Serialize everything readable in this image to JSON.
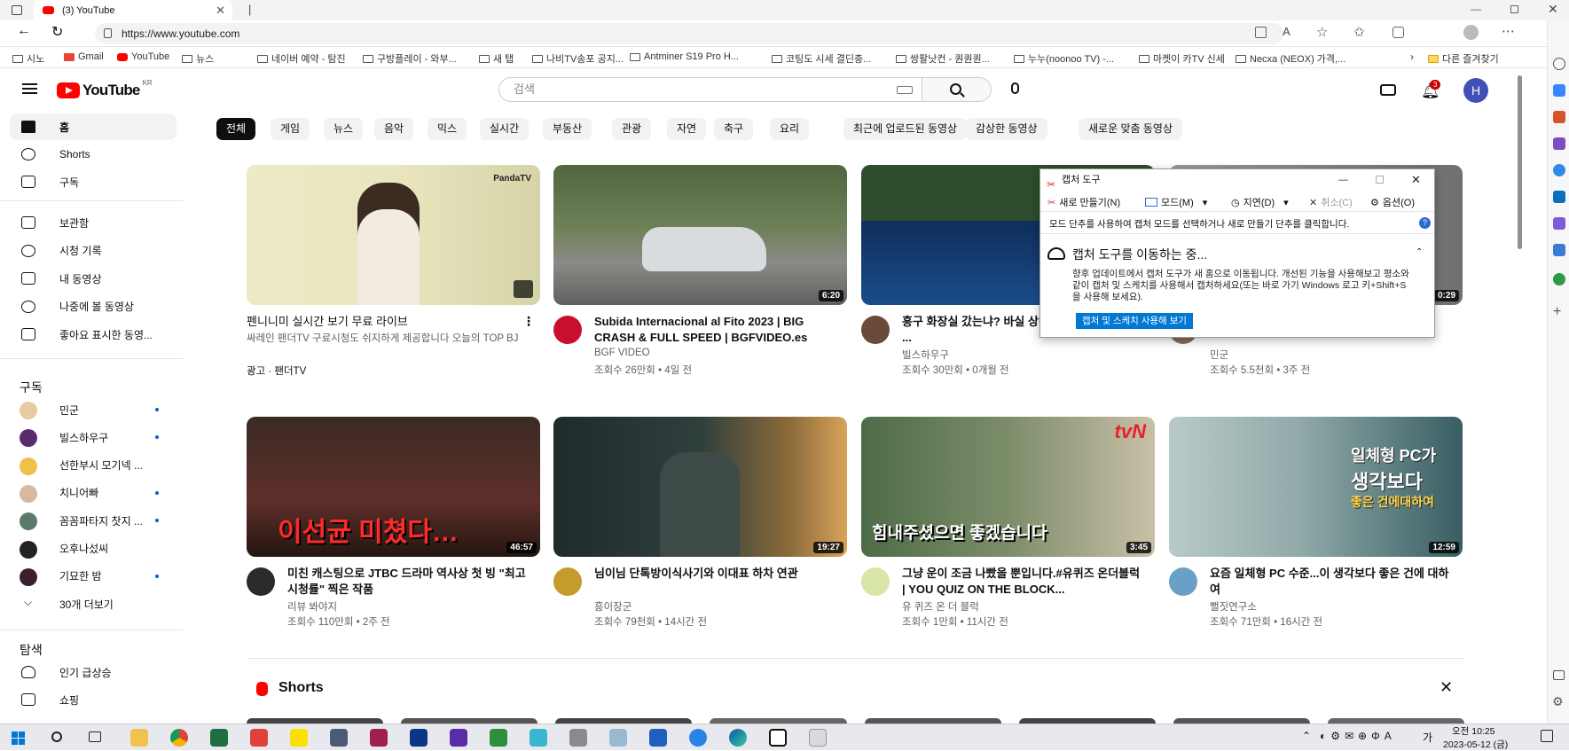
{
  "browser": {
    "tab_title": "(3) YouTube",
    "url": "https://www.youtube.com",
    "bookmarks": [
      "시노",
      "Gmail",
      "YouTube",
      "뉴스",
      "네이버 예약 - 탐진",
      "구방플레이 - 와부...",
      "새 탭",
      "나비TV송포 공지...",
      "Antminer S19 Pro H...",
      "코팅도 시세 결딘충...",
      "쌍팔낫컨 - 퀀퀀퀀...",
      "누누(noonoo TV) -...",
      "마켓이 카TV 신세",
      "Necxa (NEOX) 가격,...",
      "다른 즐겨찾기"
    ]
  },
  "youtube": {
    "logo": "YouTube",
    "region": "KR",
    "search_placeholder": "검색",
    "notif_count": "3",
    "avatar_letter": "H"
  },
  "sidebar": {
    "main": [
      "홈",
      "Shorts",
      "구독"
    ],
    "library": [
      "보관함",
      "시청 기록",
      "내 동영상",
      "나중에 볼 동영상",
      "좋아요 표시한 동영..."
    ],
    "subs_title": "구독",
    "subs": [
      "민군",
      "빌스하우구",
      "선한부시 모기넥 ...",
      "치니어빠",
      "꼼꼼파타지 찻지 ...",
      "오후나섰씨",
      "기묘한 밤"
    ],
    "more": "30개 더보기",
    "explore_title": "탐색",
    "explore": [
      "인기 급상승",
      "쇼핑"
    ]
  },
  "chips": [
    "전체",
    "게임",
    "뉴스",
    "음악",
    "믹스",
    "실시간",
    "부동산",
    "관광",
    "자연",
    "축구",
    "요리",
    "최근에 업로드된 동영상",
    "감상한 동영상",
    "새로운 맞춤 동영상"
  ],
  "videos": [
    {
      "title": "펜니니미 실시간 보기 무료 라이브",
      "channel": "싸레인 팬더TV 구료시청도 쉬지하게 제공합니다 오늘의 TOP BJ",
      "meta": "광고 · 팬더TV",
      "dur": "",
      "color": "#d9d6b4"
    },
    {
      "title": "Subida Internacional al Fito 2023 | BIG CRASH & FULL SPEED | BGFVIDEO.es",
      "channel": "BGF VIDEO",
      "meta": "조회수 26만회 • 4일 전",
      "dur": "6:20",
      "color": "#5b6b4a"
    },
    {
      "title": "흥구 화장실 갔는냐? 바실 상냐!? ... 시신은 설설 ...",
      "channel": "빌스하우구",
      "meta": "조회수 30만회 • 0개월 전",
      "dur": "",
      "color": "#1f3f6e"
    },
    {
      "title": "",
      "channel": "민군",
      "meta": "조회수 5.5천회 • 3주 전",
      "dur": "0:29",
      "color": "#7a7a7a"
    },
    {
      "title": "미친 캐스팅으로 JTBC 드라마 역사상 첫 빙 \"최고 시청률\" 찍은 작품",
      "channel": "리뷰 봐야지",
      "meta": "조회수 110만회 • 2주 전",
      "dur": "46:57",
      "color": "#6a2a22"
    },
    {
      "title": "님이님 단톡방이식사기와 이대표 하차 연관",
      "channel": "흥이장군",
      "meta": "조회수 79천회 • 14시간 전",
      "dur": "19:27",
      "color": "#2f3d3a"
    },
    {
      "title": "그냥 운이 조금 나빴을 뿐입니다.#유퀴즈 온더블럭 | YOU QUIZ ON THE BLOCK...",
      "channel": "유 퀴즈 온 더 블럭",
      "meta": "조회수 1만회 • 11시간 전",
      "dur": "3:45",
      "color": "#3f5c3a"
    },
    {
      "title": "요즘 일체형 PC 수준...이 생각보다 좋은 건에 대하여",
      "channel": "뻘짓연구소",
      "meta": "조회수 71만회 • 16시간 전",
      "dur": "12:59",
      "color": "#8fa9a8"
    }
  ],
  "thumb_text": {
    "v5": "이선균 미쳤다…",
    "v7": "힘내주셨으면 좋겠습니다",
    "v8a": "일체형 PC가",
    "v8b": "생각보다",
    "v8c": "좋은 건에대하여",
    "tvn": "tvN",
    "panda": "PandaTV"
  },
  "shorts_label": "Shorts",
  "snip": {
    "title": "캡처 도구",
    "toolbar": [
      "새로 만들기(N)",
      "모드(M)",
      "지연(D)",
      "취소(C)",
      "옵션(O)"
    ],
    "message": "모드 단추를 사용하여 캡처 모드를 선택하거나 새로 만들기 단추를 클릭합니다.",
    "heading": "캡처 도구를 이동하는 중...",
    "body": "향후 업데이트에서 캡처 도구가 새 홈으로 이동됩니다. 개선된 기능을 사용해보고 평소와 같이 캡처 및 스케치를 사용해서 캡처하세요(또는 바로 가기 Windows 로고 키+Shift+S을 사용해 보세요).",
    "button": "캡처 및 스케치 사용해 보기"
  },
  "taskbar": {
    "time": "오전 10:25",
    "date": "2023-05-12 (금)"
  },
  "colors": {
    "youtube_red": "#ff0000",
    "accent": "#065fd4",
    "snip_button": "#0078d4"
  }
}
